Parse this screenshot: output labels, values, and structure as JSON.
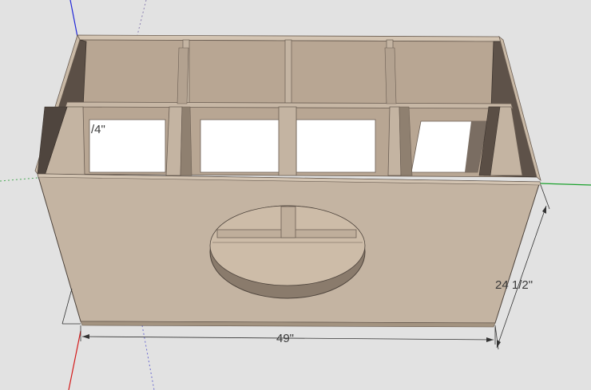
{
  "dimensions": {
    "width_label": "49\"",
    "depth_label": "24 1/2\"",
    "partial_label": "/4\""
  },
  "colors": {
    "background": "#e2e2e2",
    "board_face": "#c4b4a2",
    "board_edge": "#9f8f7e",
    "board_dark": "#5a4e45",
    "interior": "#b5a391",
    "opening": "#ffffff",
    "axis_red": "#d41c1c",
    "axis_green": "#1aa12c",
    "axis_blue": "#2228d8"
  }
}
